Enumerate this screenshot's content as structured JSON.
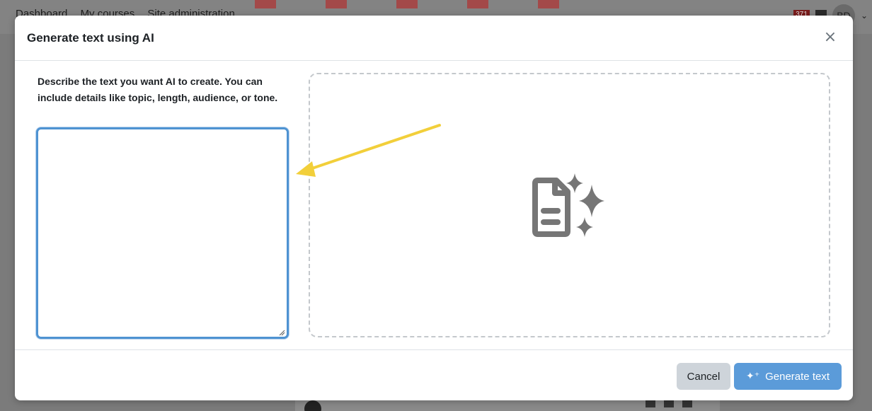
{
  "background": {
    "nav_items": [
      "Dashboard",
      "My courses",
      "Site administration"
    ],
    "notification_count": "371",
    "user_initials": "BD"
  },
  "modal": {
    "title": "Generate text using AI",
    "close_label": "×",
    "prompt_label": "Describe the text you want AI to create. You can include details like topic, length, audience, or tone.",
    "prompt_value": "",
    "preview_icon": "document-sparkle-icon"
  },
  "footer": {
    "cancel_label": "Cancel",
    "generate_label": "Generate text",
    "generate_icon": "sparkle-icon"
  },
  "annotation": {
    "arrow_color": "#f2cf3a"
  },
  "colors": {
    "primary": "#5b9bd9",
    "focus_border": "#4f93d2",
    "secondary": "#ced4da"
  }
}
